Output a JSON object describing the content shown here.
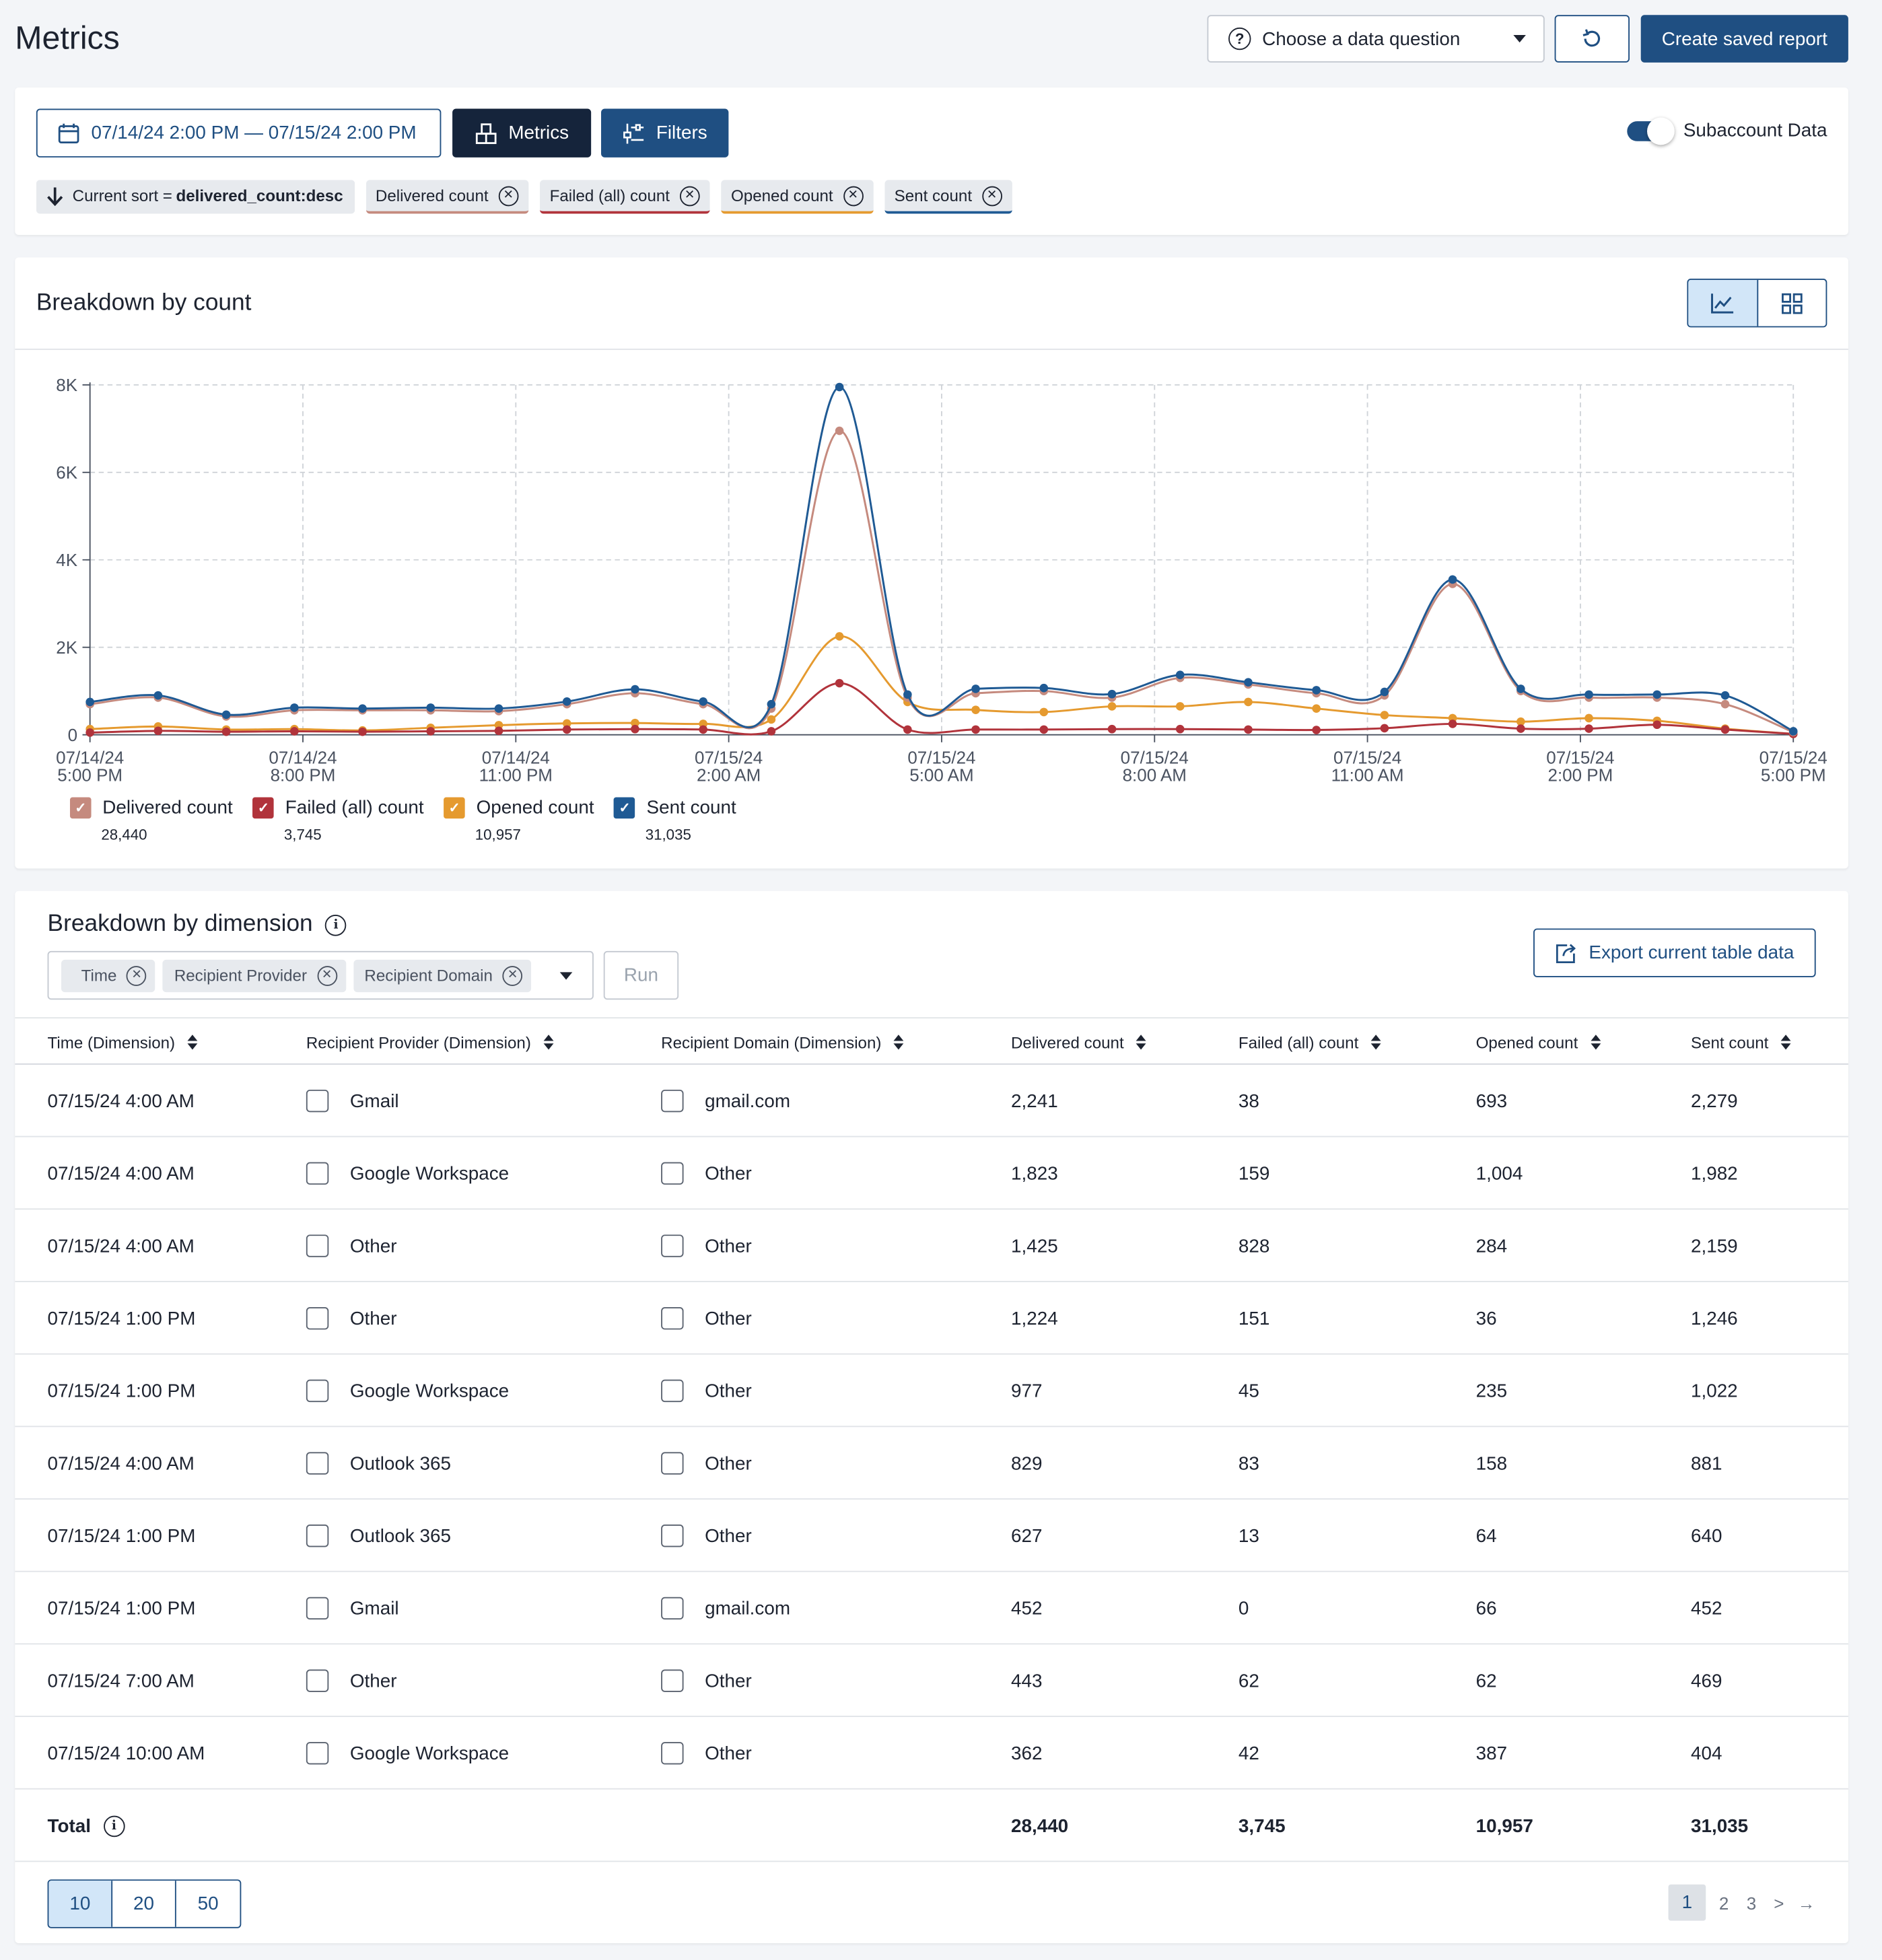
{
  "header": {
    "title": "Metrics",
    "data_question_label": "Choose a data question",
    "reset_icon": "refresh-icon",
    "create_report_label": "Create saved report"
  },
  "controls": {
    "date_range": "07/14/24 2:00 PM — 07/15/24 2:00 PM",
    "metrics_label": "Metrics",
    "filters_label": "Filters",
    "subaccount_label": "Subaccount Data",
    "subaccount_enabled": true,
    "sort_prefix": "Current sort =",
    "sort_value": "delivered_count:desc",
    "metric_chips": [
      {
        "label": "Delivered count",
        "color": "#c58a7e"
      },
      {
        "label": "Failed (all) count",
        "color": "#b1333b"
      },
      {
        "label": "Opened count",
        "color": "#e59a2f"
      },
      {
        "label": "Sent count",
        "color": "#1f5a94"
      }
    ]
  },
  "chart_card": {
    "title": "Breakdown by count",
    "view_modes": [
      "line-chart-icon",
      "grid-icon"
    ],
    "active_view": "line-chart-icon"
  },
  "chart_data": {
    "type": "line",
    "y_ticks": [
      "0",
      "2K",
      "4K",
      "6K",
      "8K"
    ],
    "ylim": [
      0,
      8000
    ],
    "grid": true,
    "x_ticks": [
      {
        "line1": "07/14/24",
        "line2": "5:00 PM"
      },
      {
        "line1": "07/14/24",
        "line2": "8:00 PM"
      },
      {
        "line1": "07/14/24",
        "line2": "11:00 PM"
      },
      {
        "line1": "07/15/24",
        "line2": "2:00 AM"
      },
      {
        "line1": "07/15/24",
        "line2": "5:00 AM"
      },
      {
        "line1": "07/15/24",
        "line2": "8:00 AM"
      },
      {
        "line1": "07/15/24",
        "line2": "11:00 AM"
      },
      {
        "line1": "07/15/24",
        "line2": "2:00 PM"
      },
      {
        "line1": "07/15/24",
        "line2": "5:00 PM"
      }
    ],
    "series": [
      {
        "name": "Delivered count",
        "color": "#c58a7e",
        "total": "28,440",
        "values": [
          700,
          850,
          420,
          560,
          560,
          560,
          540,
          700,
          950,
          700,
          600,
          6950,
          850,
          950,
          1000,
          850,
          1300,
          1150,
          950,
          900,
          3450,
          1000,
          850,
          850,
          700,
          60
        ]
      },
      {
        "name": "Failed (all) count",
        "color": "#b1333b",
        "total": "3,745",
        "values": [
          50,
          90,
          70,
          80,
          70,
          80,
          90,
          120,
          130,
          120,
          80,
          1180,
          120,
          120,
          120,
          130,
          130,
          120,
          110,
          150,
          250,
          140,
          140,
          230,
          120,
          20
        ]
      },
      {
        "name": "Opened count",
        "color": "#e59a2f",
        "total": "10,957",
        "values": [
          130,
          190,
          120,
          130,
          100,
          160,
          220,
          260,
          270,
          250,
          350,
          2250,
          750,
          570,
          520,
          650,
          650,
          750,
          600,
          450,
          380,
          300,
          380,
          320,
          140,
          20
        ]
      },
      {
        "name": "Sent count",
        "color": "#1f5a94",
        "total": "31,035",
        "values": [
          750,
          900,
          460,
          620,
          600,
          620,
          600,
          760,
          1040,
          760,
          700,
          7950,
          920,
          1050,
          1070,
          930,
          1370,
          1200,
          1020,
          980,
          3550,
          1050,
          920,
          920,
          900,
          80
        ]
      }
    ]
  },
  "dimension_card": {
    "title": "Breakdown by dimension",
    "dimension_chips": [
      "Time",
      "Recipient Provider",
      "Recipient Domain"
    ],
    "run_label": "Run",
    "export_label": "Export current table data",
    "columns": [
      "Time (Dimension)",
      "Recipient Provider (Dimension)",
      "Recipient Domain (Dimension)",
      "Delivered count",
      "Failed (all) count",
      "Opened count",
      "Sent count"
    ],
    "rows": [
      [
        "07/15/24 4:00 AM",
        "Gmail",
        "gmail.com",
        "2,241",
        "38",
        "693",
        "2,279"
      ],
      [
        "07/15/24 4:00 AM",
        "Google Workspace",
        "Other",
        "1,823",
        "159",
        "1,004",
        "1,982"
      ],
      [
        "07/15/24 4:00 AM",
        "Other",
        "Other",
        "1,425",
        "828",
        "284",
        "2,159"
      ],
      [
        "07/15/24 1:00 PM",
        "Other",
        "Other",
        "1,224",
        "151",
        "36",
        "1,246"
      ],
      [
        "07/15/24 1:00 PM",
        "Google Workspace",
        "Other",
        "977",
        "45",
        "235",
        "1,022"
      ],
      [
        "07/15/24 4:00 AM",
        "Outlook 365",
        "Other",
        "829",
        "83",
        "158",
        "881"
      ],
      [
        "07/15/24 1:00 PM",
        "Outlook 365",
        "Other",
        "627",
        "13",
        "64",
        "640"
      ],
      [
        "07/15/24 1:00 PM",
        "Gmail",
        "gmail.com",
        "452",
        "0",
        "66",
        "452"
      ],
      [
        "07/15/24 7:00 AM",
        "Other",
        "Other",
        "443",
        "62",
        "62",
        "469"
      ],
      [
        "07/15/24 10:00 AM",
        "Google Workspace",
        "Other",
        "362",
        "42",
        "387",
        "404"
      ]
    ],
    "total_label": "Total",
    "totals": [
      "28,440",
      "3,745",
      "10,957",
      "31,035"
    ],
    "page_sizes": [
      "10",
      "20",
      "50"
    ],
    "active_page_size": "10",
    "pages": [
      "1",
      "2",
      "3",
      ">",
      "→"
    ],
    "active_page": "1"
  }
}
